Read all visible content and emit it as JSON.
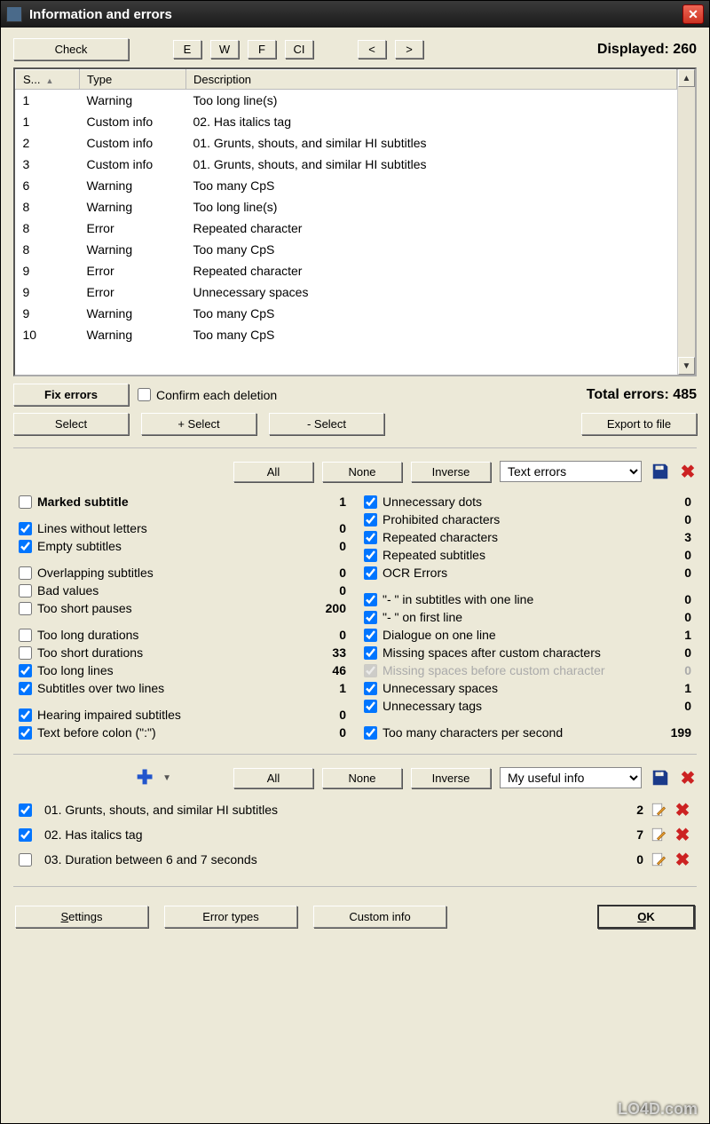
{
  "title": "Information and errors",
  "toolbar": {
    "check": "Check",
    "e": "E",
    "w": "W",
    "f": "F",
    "ci": "CI",
    "prev": "<",
    "next": ">",
    "displayed_label": "Displayed:",
    "displayed_count": "260"
  },
  "table": {
    "headers": {
      "s": "S...",
      "type": "Type",
      "desc": "Description"
    },
    "rows": [
      {
        "s": "1",
        "type": "Warning",
        "desc": "Too long line(s)"
      },
      {
        "s": "1",
        "type": "Custom info",
        "desc": "02. Has italics tag"
      },
      {
        "s": "2",
        "type": "Custom info",
        "desc": "01. Grunts, shouts, and similar HI subtitles"
      },
      {
        "s": "3",
        "type": "Custom info",
        "desc": "01. Grunts, shouts, and similar HI subtitles"
      },
      {
        "s": "6",
        "type": "Warning",
        "desc": "Too many CpS"
      },
      {
        "s": "8",
        "type": "Warning",
        "desc": "Too long line(s)"
      },
      {
        "s": "8",
        "type": "Error",
        "desc": "Repeated character"
      },
      {
        "s": "8",
        "type": "Warning",
        "desc": "Too many CpS"
      },
      {
        "s": "9",
        "type": "Error",
        "desc": "Repeated character"
      },
      {
        "s": "9",
        "type": "Error",
        "desc": "Unnecessary spaces"
      },
      {
        "s": "9",
        "type": "Warning",
        "desc": "Too many CpS"
      },
      {
        "s": "10",
        "type": "Warning",
        "desc": "Too many CpS"
      }
    ]
  },
  "fix": {
    "fix_errors": "Fix errors",
    "confirm": "Confirm each deletion",
    "total_label": "Total errors:",
    "total_count": "485",
    "select": "Select",
    "plus_select": "+ Select",
    "minus_select": "- Select",
    "export": "Export to file"
  },
  "filter1": {
    "all": "All",
    "none": "None",
    "inverse": "Inverse",
    "preset": "Text errors"
  },
  "checks_left": [
    {
      "on": false,
      "bold": true,
      "label": "Marked subtitle",
      "count": "1"
    },
    {
      "on": true,
      "label": "Lines without letters",
      "count": "0",
      "gap": true
    },
    {
      "on": true,
      "label": "Empty subtitles",
      "count": "0"
    },
    {
      "on": false,
      "label": "Overlapping subtitles",
      "count": "0",
      "gap": true
    },
    {
      "on": false,
      "label": "Bad values",
      "count": "0"
    },
    {
      "on": false,
      "label": "Too short pauses",
      "count": "200"
    },
    {
      "on": false,
      "label": "Too long durations",
      "count": "0",
      "gap": true
    },
    {
      "on": false,
      "label": "Too short durations",
      "count": "33"
    },
    {
      "on": true,
      "label": "Too long lines",
      "count": "46"
    },
    {
      "on": true,
      "label": "Subtitles over two lines",
      "count": "1"
    },
    {
      "on": true,
      "label": "Hearing impaired subtitles",
      "count": "0",
      "gap": true
    },
    {
      "on": true,
      "label": "Text before colon (\":\")",
      "count": "0"
    }
  ],
  "checks_right": [
    {
      "on": true,
      "label": "Unnecessary dots",
      "count": "0"
    },
    {
      "on": true,
      "label": "Prohibited characters",
      "count": "0"
    },
    {
      "on": true,
      "label": "Repeated characters",
      "count": "3"
    },
    {
      "on": true,
      "label": "Repeated subtitles",
      "count": "0"
    },
    {
      "on": true,
      "label": "OCR Errors",
      "count": "0"
    },
    {
      "on": true,
      "label": "\"- \" in subtitles with one line",
      "count": "0",
      "gap": true
    },
    {
      "on": true,
      "label": "\"- \" on first line",
      "count": "0"
    },
    {
      "on": true,
      "label": "Dialogue on one line",
      "count": "1"
    },
    {
      "on": true,
      "label": "Missing spaces after custom characters",
      "count": "0"
    },
    {
      "on": true,
      "disabled": true,
      "label": "Missing spaces before custom character",
      "count": "0"
    },
    {
      "on": true,
      "label": "Unnecessary spaces",
      "count": "1"
    },
    {
      "on": true,
      "label": "Unnecessary tags",
      "count": "0"
    },
    {
      "on": true,
      "label": "Too many characters per second",
      "count": "199",
      "gap": true
    }
  ],
  "filter2": {
    "all": "All",
    "none": "None",
    "inverse": "Inverse",
    "preset": "My useful info"
  },
  "custom": [
    {
      "on": true,
      "label": "01. Grunts, shouts, and similar HI subtitles",
      "count": "2"
    },
    {
      "on": true,
      "label": "02. Has italics tag",
      "count": "7"
    },
    {
      "on": false,
      "label": "03. Duration between 6 and 7 seconds",
      "count": "0"
    }
  ],
  "bottom": {
    "settings_pre": "S",
    "settings": "ettings",
    "error_types": "Error types",
    "custom_info": "Custom info",
    "ok_pre": "O",
    "ok": "K"
  },
  "watermark": "LO4D.com"
}
